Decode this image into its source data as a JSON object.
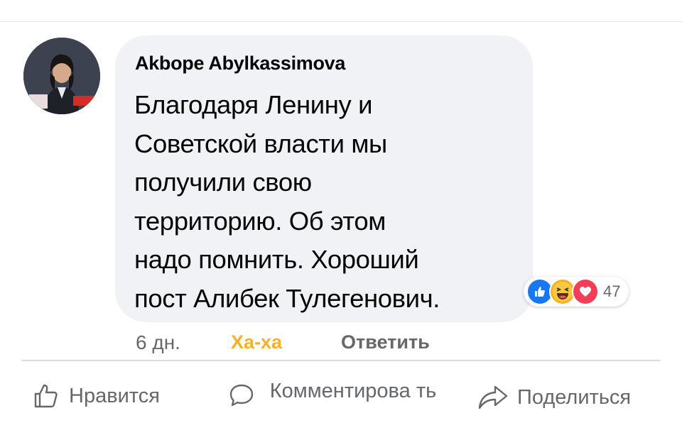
{
  "comment": {
    "author": "Akbope Abylkassimova",
    "text": "Благодаря Ленину и\nСоветской власти мы\nполучили свою\nтерриторию. Об этом\nнадо помнить. Хороший\nпост Алибек Тулегенович.",
    "time": "6 дн.",
    "reaction_given": "Ха-ха",
    "reply_label": "Ответить",
    "reactions": {
      "icons": [
        "like-icon",
        "haha-icon",
        "love-icon"
      ],
      "count": "47"
    }
  },
  "post_actions": {
    "like_label": "Нравится",
    "comment_label": "Комментирова ть",
    "share_label": "Поделиться"
  },
  "colors": {
    "bubble": "#f0f2f5",
    "haha_accent": "#f7b125",
    "secondary_text": "#65676b",
    "like_blue": "#1877f2",
    "love_red": "#f33e58"
  }
}
